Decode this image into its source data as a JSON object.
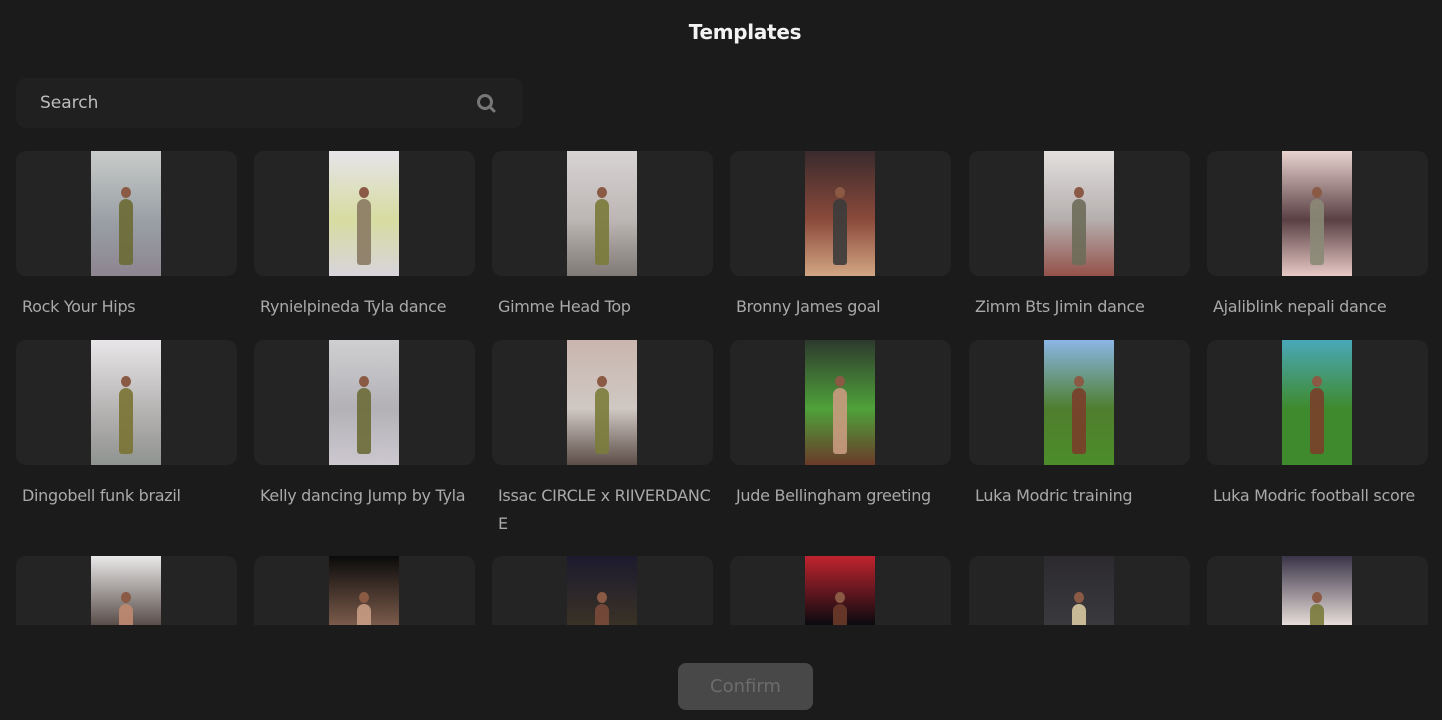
{
  "header": {
    "title": "Templates"
  },
  "search": {
    "placeholder": "Search",
    "value": "",
    "icon": "search-icon"
  },
  "templates": [
    {
      "label": "Rock Your Hips",
      "thumb": {
        "top": "#c9ccc9",
        "mid": "#9aa0a6",
        "bottom": "#8d8590",
        "figure": "#6b6a34"
      }
    },
    {
      "label": "Rynielpineda Tyla dance",
      "thumb": {
        "top": "#e6e4ea",
        "mid": "#d7dca0",
        "bottom": "#d8d4dc",
        "figure": "#8a7a63"
      }
    },
    {
      "label": "Gimme Head Top",
      "thumb": {
        "top": "#d8d4d4",
        "mid": "#bcb6b4",
        "bottom": "#7f7a76",
        "figure": "#7a7a3a"
      }
    },
    {
      "label": "Bronny James goal",
      "thumb": {
        "top": "#3a2a2e",
        "mid": "#8b4a3a",
        "bottom": "#d2a684",
        "figure": "#3b3b3b"
      }
    },
    {
      "label": "Zimm Bts Jimin dance",
      "thumb": {
        "top": "#e2e0de",
        "mid": "#b5aeae",
        "bottom": "#94524a",
        "figure": "#6d6c59"
      }
    },
    {
      "label": "Ajaliblink nepali dance",
      "thumb": {
        "top": "#e9d3cf",
        "mid": "#5a4044",
        "bottom": "#e7c9c5",
        "figure": "#8b8a77"
      }
    },
    {
      "label": "Dingobell funk brazil",
      "thumb": {
        "top": "#e8e6e8",
        "mid": "#b7b4b4",
        "bottom": "#8f938f",
        "figure": "#7a7334"
      }
    },
    {
      "label": "Kelly dancing Jump by Tyla",
      "thumb": {
        "top": "#cfcfd1",
        "mid": "#b3b1b6",
        "bottom": "#cdc8d0",
        "figure": "#6c6b38"
      }
    },
    {
      "label": "Issac CIRCLE x RIIVERDANCE",
      "thumb": {
        "top": "#c9b6ae",
        "mid": "#d0c8c3",
        "bottom": "#5c4d48",
        "figure": "#7b7c3c"
      }
    },
    {
      "label": "Jude Bellingham greeting",
      "thumb": {
        "top": "#2d3a2d",
        "mid": "#4fa13a",
        "bottom": "#6a3a2a",
        "figure": "#c99b80"
      }
    },
    {
      "label": "Luka Modric training",
      "thumb": {
        "top": "#8bb6e6",
        "mid": "#4e7e2e",
        "bottom": "#4d8d2a",
        "figure": "#7a3e2a"
      }
    },
    {
      "label": "Luka Modric football score",
      "thumb": {
        "top": "#49a8b8",
        "mid": "#3f8a2d",
        "bottom": "#3f8a2d",
        "figure": "#7a3e2a"
      }
    },
    {
      "label": "",
      "thumb": {
        "top": "#e9e9e9",
        "mid": "#5a4e4a",
        "bottom": "#2a2a2e",
        "figure": "#c08a70"
      }
    },
    {
      "label": "",
      "thumb": {
        "top": "#0b0b0b",
        "mid": "#7a5a4a",
        "bottom": "#4a3b33",
        "figure": "#c89c84"
      }
    },
    {
      "label": "",
      "thumb": {
        "top": "#1c1a2e",
        "mid": "#3a3226",
        "bottom": "#3a2a22",
        "figure": "#7a4a3a"
      }
    },
    {
      "label": "",
      "thumb": {
        "top": "#c0242e",
        "mid": "#0a0a10",
        "bottom": "#2a1a1e",
        "figure": "#6b3a2a"
      }
    },
    {
      "label": "",
      "thumb": {
        "top": "#2c2a2e",
        "mid": "#3a3a3e",
        "bottom": "#2a2a2c",
        "figure": "#d8c8a0"
      }
    },
    {
      "label": "",
      "thumb": {
        "top": "#3a3448",
        "mid": "#e6dcd8",
        "bottom": "#d9cabd",
        "figure": "#7a7a3a"
      }
    }
  ],
  "footer": {
    "confirm_label": "Confirm"
  }
}
